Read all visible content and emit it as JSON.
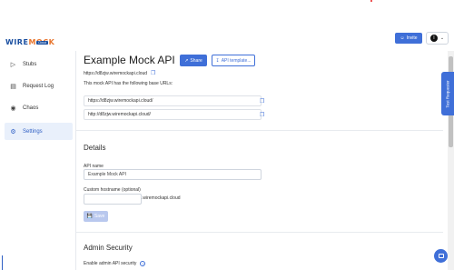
{
  "brand": {
    "name_main": "WIRE",
    "name_accent": "MOCK",
    "sub": "Cloud"
  },
  "header": {
    "invite_label": "Invite",
    "user_initial": "I"
  },
  "sidebar": {
    "items": [
      {
        "label": "Stubs",
        "icon": "play-icon"
      },
      {
        "label": "Request Log",
        "icon": "document-icon"
      },
      {
        "label": "Chaos",
        "icon": "chaos-icon"
      },
      {
        "label": "Settings",
        "icon": "gear-icon",
        "active": true
      }
    ]
  },
  "main": {
    "title": "Example Mock API",
    "share_label": "Share",
    "template_label": "API template...",
    "api_host": "https://d8zjw.wiremockapi.cloud",
    "base_urls_text": "This mock API has the following base URLs:",
    "base_urls": [
      "https://d8zjw.wiremockapi.cloud/",
      "http://d8zjw.wiremockapi.cloud/"
    ],
    "details_title": "Details",
    "api_name_label": "API name",
    "api_name_value": "Example Mock API",
    "hostname_label": "Custom hostname (optional)",
    "hostname_suffix": ".wiremockapi.cloud",
    "save_label": "Save",
    "admin_title": "Admin Security",
    "enable_admin_label": "Enable admin API security"
  },
  "test_requester_label": "Test Requester",
  "colors": {
    "accent": "#3f6fd8",
    "brand": "#1a4fa0",
    "brand_accent": "#e8742c"
  }
}
